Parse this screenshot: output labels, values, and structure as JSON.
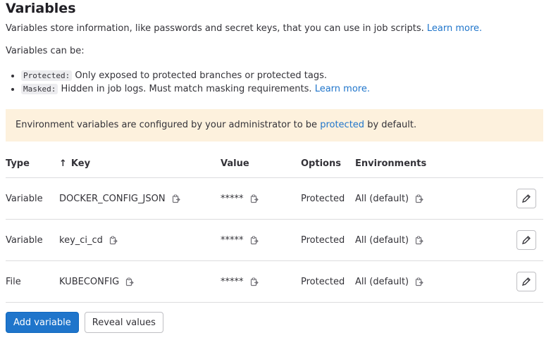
{
  "header": {
    "title": "Variables",
    "description": "Variables store information, like passwords and secret keys, that you can use in job scripts.",
    "learn_more": "Learn more."
  },
  "intro": {
    "can_be": "Variables can be:"
  },
  "options_list": [
    {
      "code": "Protected:",
      "text": "Only exposed to protected branches or protected tags."
    },
    {
      "code": "Masked:",
      "text": "Hidden in job logs. Must match masking requirements.",
      "link": "Learn more."
    }
  ],
  "alert": {
    "before": "Environment variables are configured by your administrator to be",
    "link": "protected",
    "after": "by default."
  },
  "table": {
    "headers": {
      "type": "Type",
      "key": "Key",
      "value": "Value",
      "options": "Options",
      "environments": "Environments"
    },
    "sort_icon": "arrow-up-icon",
    "rows": [
      {
        "type": "Variable",
        "key": "DOCKER_CONFIG_JSON",
        "value": "*****",
        "options": "Protected",
        "environments": "All (default)"
      },
      {
        "type": "Variable",
        "key": "key_ci_cd",
        "value": "*****",
        "options": "Protected",
        "environments": "All (default)"
      },
      {
        "type": "File",
        "key": "KUBECONFIG",
        "value": "*****",
        "options": "Protected",
        "environments": "All (default)"
      }
    ]
  },
  "actions": {
    "add": "Add variable",
    "reveal": "Reveal values"
  },
  "colors": {
    "accent": "#1f75cb",
    "alert_bg": "#fdf1dd",
    "border": "#dcdcde"
  }
}
